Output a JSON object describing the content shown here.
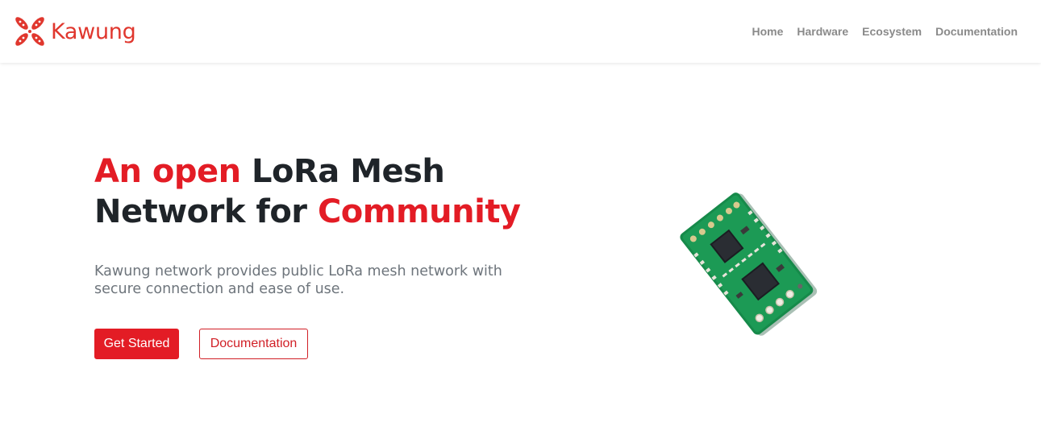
{
  "brand": {
    "name": "Kawung",
    "logo_icon": "kawung-logo-icon",
    "color": "#e0372e"
  },
  "nav": {
    "items": [
      "Home",
      "Hardware",
      "Ecosystem",
      "Documentation"
    ]
  },
  "hero": {
    "title": {
      "part1_accent": "An open",
      "part2": " LoRa Mesh Network for ",
      "part3_accent": "Community"
    },
    "description": "Kawung network provides public LoRa mesh network with secure connection and ease of use.",
    "primary_button": "Get Started",
    "secondary_button": "Documentation",
    "image": "lora-module-board-image"
  },
  "colors": {
    "accent": "#e31c25",
    "text_dark": "#1f2429",
    "text_muted": "#6e757c",
    "nav": "#8a8a8a"
  }
}
